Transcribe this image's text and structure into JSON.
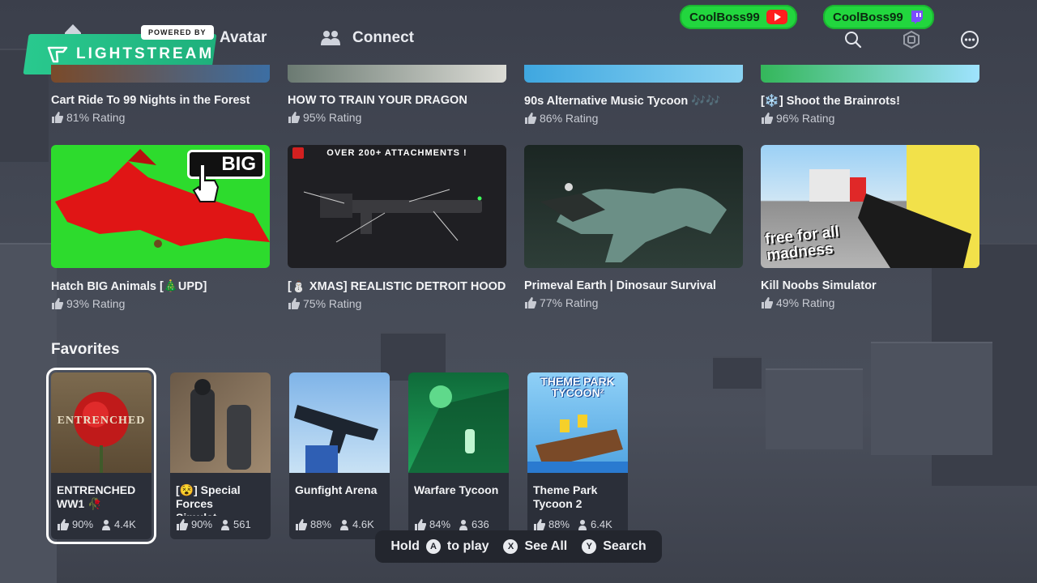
{
  "nav": {
    "avatar_label": "Avatar",
    "connect_label": "Connect"
  },
  "overlay": {
    "powered_by": "POWERED BY",
    "brand": "LIGHTSTREAM",
    "badges": [
      {
        "name": "CoolBoss99",
        "platform": "youtube"
      },
      {
        "name": "CoolBoss99",
        "platform": "twitch"
      }
    ]
  },
  "top_row": [
    {
      "title": "Cart Ride To 99 Nights in the Forest",
      "rating": "81% Rating"
    },
    {
      "title": "HOW TO TRAIN YOUR DRAGON",
      "rating": "95% Rating"
    },
    {
      "title": "90s Alternative Music Tycoon 🎶🎶",
      "rating": "86% Rating"
    },
    {
      "title": "[❄️] Shoot the Brainrots!",
      "rating": "96% Rating"
    }
  ],
  "second_row": [
    {
      "title": "Hatch BIG Animals [🎄UPD]",
      "rating": "93% Rating",
      "thumb_text": "BIG"
    },
    {
      "title": "[⛄ XMAS] REALISTIC DETROIT HOOD ...",
      "rating": "75% Rating",
      "thumb_text": "OVER 200+ ATTACHMENTS !"
    },
    {
      "title": "Primeval Earth | Dinosaur Survival",
      "rating": "77% Rating"
    },
    {
      "title": "Kill Noobs Simulator",
      "rating": "49% Rating",
      "thumb_text": "free for all madness"
    }
  ],
  "favorites": {
    "title": "Favorites",
    "items": [
      {
        "name": "ENTRENCHED WW1 🥀",
        "rating": "90%",
        "players": "4.4K",
        "thumb_text": "ENTRENCHED"
      },
      {
        "name": "[😵] Special Forces Simulat...",
        "rating": "90%",
        "players": "561"
      },
      {
        "name": "Gunfight Arena",
        "rating": "88%",
        "players": "4.6K"
      },
      {
        "name": "Warfare Tycoon",
        "rating": "84%",
        "players": "636"
      },
      {
        "name": "Theme Park Tycoon 2",
        "rating": "88%",
        "players": "6.4K",
        "thumb_text": "THEME PARK TYCOON²"
      }
    ]
  },
  "hints": {
    "hold": "Hold",
    "a_glyph": "A",
    "to_play": "to play",
    "x_glyph": "X",
    "see_all": "See All",
    "y_glyph": "Y",
    "search": "Search"
  },
  "colors": {
    "badge_green": "#22d63e",
    "lightstream_green": "#29c98e",
    "hint_bar": "#23262e"
  }
}
